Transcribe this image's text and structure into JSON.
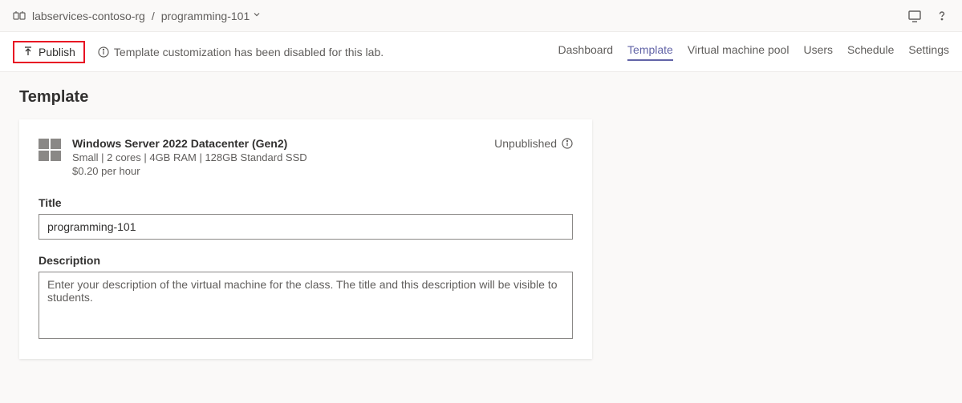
{
  "breadcrumb": {
    "parent": "labservices-contoso-rg",
    "current": "programming-101"
  },
  "toolbar": {
    "publish_label": "Publish",
    "info_message": "Template customization has been disabled for this lab."
  },
  "nav": {
    "tabs": [
      {
        "label": "Dashboard",
        "active": false
      },
      {
        "label": "Template",
        "active": true
      },
      {
        "label": "Virtual machine pool",
        "active": false
      },
      {
        "label": "Users",
        "active": false
      },
      {
        "label": "Schedule",
        "active": false
      },
      {
        "label": "Settings",
        "active": false
      }
    ]
  },
  "page": {
    "title": "Template"
  },
  "vm": {
    "name": "Windows Server 2022 Datacenter (Gen2)",
    "specs": "Small | 2 cores | 4GB RAM | 128GB Standard SSD",
    "price": "$0.20 per hour",
    "status": "Unpublished"
  },
  "form": {
    "title_label": "Title",
    "title_value": "programming-101",
    "description_label": "Description",
    "description_placeholder": "Enter your description of the virtual machine for the class. The title and this description will be visible to students."
  }
}
